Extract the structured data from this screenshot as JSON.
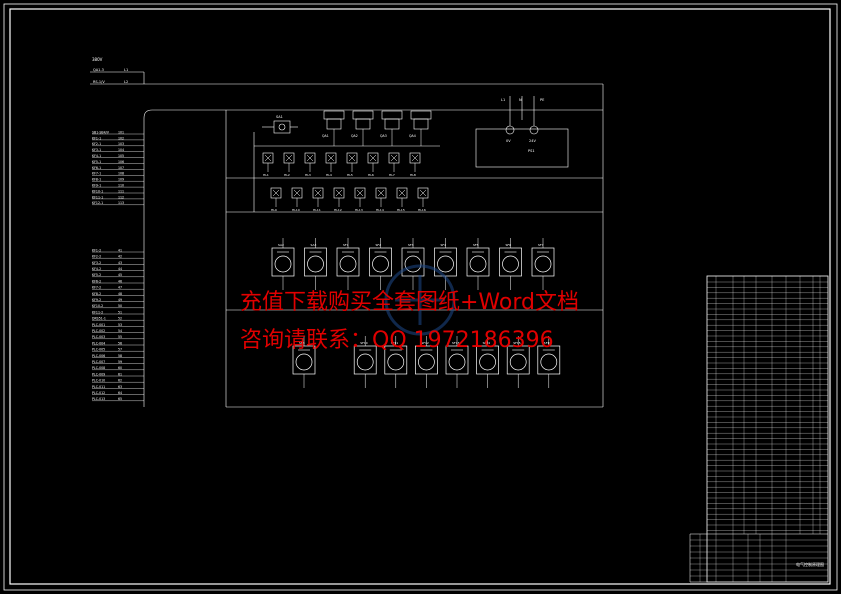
{
  "header_label": "380V",
  "bus": {
    "left_labels": [
      "QA1-3",
      "RS-1/V"
    ],
    "right_nums": [
      "L1",
      "L2"
    ]
  },
  "left_terminals": {
    "block1": [
      {
        "label": "SB1-SB4/V",
        "num": "101"
      },
      {
        "label": "KF1-1",
        "num": "102"
      },
      {
        "label": "KF2-1",
        "num": "103"
      },
      {
        "label": "KF3-1",
        "num": "104"
      },
      {
        "label": "KF4-1",
        "num": "105"
      },
      {
        "label": "KF5-1",
        "num": "106"
      },
      {
        "label": "KF6-1",
        "num": "107"
      },
      {
        "label": "KF7-1",
        "num": "108"
      },
      {
        "label": "KF8-1",
        "num": "109"
      },
      {
        "label": "KF9-1",
        "num": "110"
      },
      {
        "label": "KF10-1",
        "num": "111"
      },
      {
        "label": "KF11-1",
        "num": "112"
      },
      {
        "label": "KF12-1",
        "num": "113"
      }
    ],
    "block2": [
      {
        "label": "KF1-2",
        "num": "41"
      },
      {
        "label": "KF2-2",
        "num": "42"
      },
      {
        "label": "KF3-2",
        "num": "43"
      },
      {
        "label": "KF4-2",
        "num": "44"
      },
      {
        "label": "KF5-2",
        "num": "45"
      },
      {
        "label": "KF6-2",
        "num": "46"
      },
      {
        "label": "KF7-2",
        "num": "47"
      },
      {
        "label": "KF8-2",
        "num": "48"
      },
      {
        "label": "KF9-2",
        "num": "49"
      },
      {
        "label": "KF10-2",
        "num": "50"
      },
      {
        "label": "KF11-2",
        "num": "51"
      },
      {
        "label": "DRS51-1",
        "num": "52"
      },
      {
        "label": "PLC-001",
        "num": "53"
      },
      {
        "label": "PLC-002",
        "num": "54"
      },
      {
        "label": "PLC-003",
        "num": "55"
      },
      {
        "label": "PLC-004",
        "num": "56"
      },
      {
        "label": "PLC-005",
        "num": "57"
      },
      {
        "label": "PLC-006",
        "num": "58"
      },
      {
        "label": "PLC-007",
        "num": "59"
      },
      {
        "label": "PLC-008",
        "num": "60"
      },
      {
        "label": "PLC-009",
        "num": "61"
      },
      {
        "label": "PLC-010",
        "num": "62"
      },
      {
        "label": "PLC-011",
        "num": "63"
      },
      {
        "label": "PLC-012",
        "num": "64"
      },
      {
        "label": "PLC-013",
        "num": "65"
      }
    ]
  },
  "top_devices": {
    "switch_label": "SA1",
    "breakers": [
      "QA1",
      "QA2",
      "QA3",
      "QA4"
    ],
    "power_module": {
      "label": "PS1",
      "in_labels": [
        "L1",
        "N",
        "PE"
      ],
      "out_labels": [
        "0V",
        "24V"
      ]
    }
  },
  "row1_lamps": [
    "HL1",
    "HL2",
    "HL3",
    "HL4",
    "HL5",
    "HL6",
    "HL7",
    "HL8"
  ],
  "row2_lamps": [
    "HL9",
    "HL10",
    "HL11",
    "HL12",
    "HL13",
    "HL14",
    "HL15",
    "HL16"
  ],
  "row3_motors": [
    "SA2",
    "SA3",
    "SF1",
    "SF2",
    "SF3",
    "SF4",
    "SF5",
    "SF6",
    "SF7"
  ],
  "row4_motors": [
    "SF8",
    "SF9",
    "SF10",
    "SF11",
    "SF12",
    "SF13",
    "SF14",
    "SF15",
    "SF16"
  ],
  "title_block": {
    "drawing_title": "电气控制原理图"
  },
  "watermark": {
    "line1": "充值下载购买全套图纸+Word文档",
    "line2": "咨询请联系：QQ 1972186396"
  },
  "colors": {
    "background": "#000000",
    "lines": "#ffffff",
    "watermark": "#e00000",
    "accent": "#1e4a8a"
  }
}
